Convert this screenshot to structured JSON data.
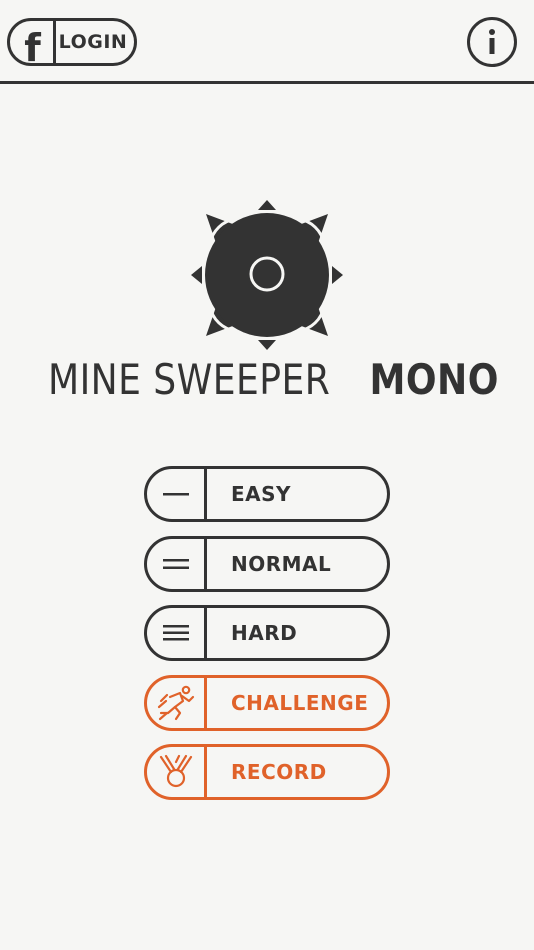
{
  "header": {
    "login_label": "LOGIN",
    "facebook_glyph": "f",
    "info_icon": "info-icon"
  },
  "logo": {
    "title_light": "MINE SWEEPER",
    "title_bold": "MONO",
    "icon": "mine-icon"
  },
  "menu": {
    "items": [
      {
        "label": "EASY",
        "icon": "one-line-icon"
      },
      {
        "label": "NORMAL",
        "icon": "two-lines-icon"
      },
      {
        "label": "HARD",
        "icon": "three-lines-icon"
      },
      {
        "label": "CHALLENGE",
        "icon": "runner-icon"
      },
      {
        "label": "RECORD",
        "icon": "medal-icon"
      }
    ]
  },
  "colors": {
    "ink": "#333333",
    "accent": "#e0622a",
    "background": "#f6f6f4"
  }
}
